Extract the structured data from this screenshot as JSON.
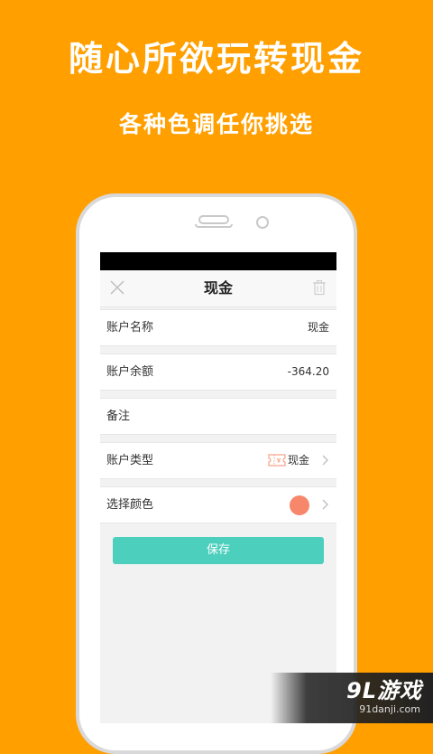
{
  "promo": {
    "headline": "随心所欲玩转现金",
    "subline": "各种色调任你挑选"
  },
  "screen": {
    "title": "现金",
    "rows": [
      {
        "label": "账户名称",
        "value": "现金"
      },
      {
        "label": "账户余额",
        "value": "-364.20"
      },
      {
        "label": "备注",
        "value": ""
      },
      {
        "label": "账户类型",
        "value": "现金"
      },
      {
        "label": "选择颜色",
        "value": ""
      }
    ],
    "save_label": "保存",
    "selected_color": "#F7876A",
    "accent_color": "#4DCFBE"
  },
  "watermark": {
    "logo": "9L游戏",
    "url": "91danji.com"
  }
}
